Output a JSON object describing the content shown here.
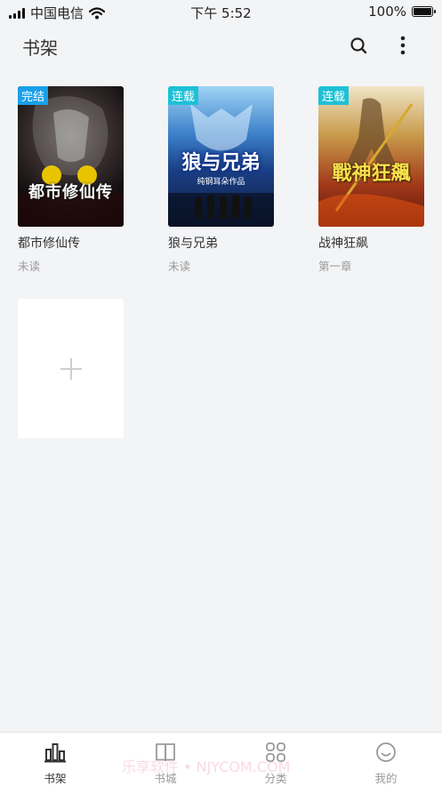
{
  "status_bar": {
    "carrier": "中国电信",
    "time": "下午 5:52",
    "battery": "100%"
  },
  "header": {
    "title": "书架",
    "search_icon": "search-icon",
    "more_icon": "more-vertical-icon"
  },
  "books": [
    {
      "title": "都市修仙传",
      "progress": "未读",
      "badge": "完结",
      "cover_text": "都市修仙传"
    },
    {
      "title": "狼与兄弟",
      "progress": "未读",
      "badge": "连载",
      "cover_text": "狼与兄弟",
      "cover_subtext": "纯钢耳朵作品"
    },
    {
      "title": "战神狂飙",
      "progress": "第一章",
      "badge": "连载",
      "cover_text": "戰神狂飆"
    }
  ],
  "add_book_icon": "plus-icon",
  "tabs": [
    {
      "label": "书架",
      "icon": "bookshelf-icon",
      "active": true
    },
    {
      "label": "书城",
      "icon": "book-open-icon",
      "active": false
    },
    {
      "label": "分类",
      "icon": "grid-icon",
      "active": false
    },
    {
      "label": "我的",
      "icon": "smile-icon",
      "active": false
    }
  ],
  "watermark": "乐享软件 • NJYCOM.COM",
  "colors": {
    "background": "#f3f4f6",
    "badge_serial": "#1ec0d6",
    "badge_done": "#1aa0e8"
  }
}
